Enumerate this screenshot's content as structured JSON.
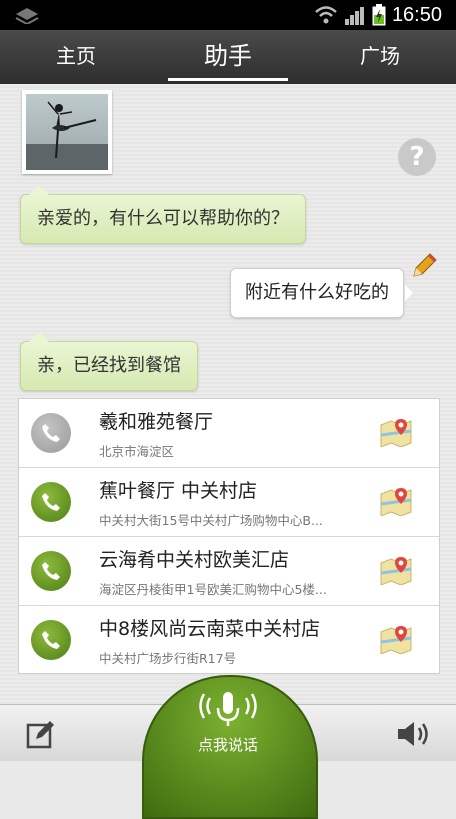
{
  "status": {
    "time": "16:50"
  },
  "tabs": [
    {
      "label": "主页"
    },
    {
      "label": "助手"
    },
    {
      "label": "广场"
    }
  ],
  "chat": {
    "assistant_greeting": "亲爱的，有什么可以帮助你的？",
    "user_query": "附近有什么好吃的",
    "assistant_found": "亲，已经找到餐馆",
    "help": "?"
  },
  "restaurants": [
    {
      "name": "羲和雅苑餐厅",
      "address": "北京市海淀区",
      "phone_status": "gray"
    },
    {
      "name": "蕉叶餐厅 中关村店",
      "address": "中关村大街15号中关村广场购物中心B...",
      "phone_status": "green"
    },
    {
      "name": "云海肴中关村欧美汇店",
      "address": "海淀区丹棱街甲1号欧美汇购物中心5楼...",
      "phone_status": "green"
    },
    {
      "name": "中8楼风尚云南菜中关村店",
      "address": "中关村广场步行街R17号",
      "phone_status": "green"
    }
  ],
  "bottom": {
    "speak_label": "点我说话"
  },
  "colors": {
    "accent_green": "#5a8f1b",
    "bubble_green": "#dcedbd"
  }
}
